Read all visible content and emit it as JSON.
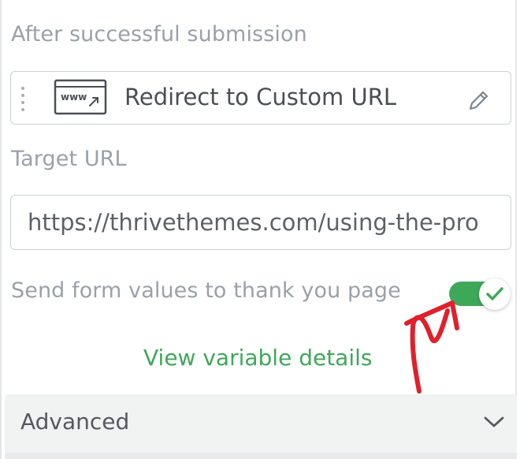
{
  "submission": {
    "section_label": "After successful submission",
    "action_label": "Redirect to Custom URL",
    "action_icon": "www-browser-icon",
    "www_text": "www"
  },
  "target": {
    "label": "Target URL",
    "value": "https://thrivethemes.com/using-the-pro"
  },
  "send_values": {
    "label": "Send form values to thank you page",
    "enabled": true,
    "accent_color": "#3ea859"
  },
  "variables_link": "View variable details",
  "advanced": {
    "label": "Advanced"
  },
  "annotation": {
    "arrow_color": "#e0202b"
  }
}
